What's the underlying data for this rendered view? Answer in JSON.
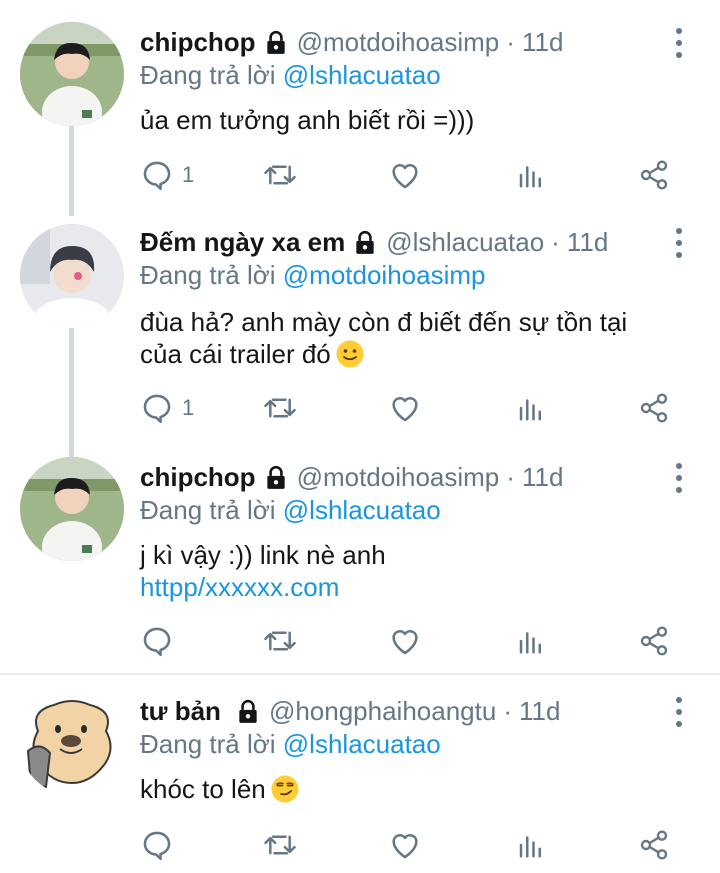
{
  "tweets": [
    {
      "name": "chipchop",
      "handle": "@motdoihoasimp",
      "dot": "·",
      "time": "11d",
      "reply_prefix": "Đang trả lời ",
      "reply_to": "@lshlacuatao",
      "text_lines": [
        "ủa em tưởng anh biết rồi =)))"
      ],
      "reply_count": "1",
      "avatar": "boy-photo-avatar"
    },
    {
      "name": "Đếm ngày xa em",
      "handle": "@lshlacuatao",
      "dot": "·",
      "time": "11d",
      "reply_prefix": "Đang trả lời ",
      "reply_to": "@motdoihoasimp",
      "text_lines": [
        "đùa hả? anh mày còn đ biết đến sự tồn tại",
        "của cái trailer đó"
      ],
      "emoji": "slightly-smiling-face",
      "reply_count": "1",
      "avatar": "selfie-photo-avatar"
    },
    {
      "name": "chipchop",
      "handle": "@motdoihoasimp",
      "dot": "·",
      "time": "11d",
      "reply_prefix": "Đang trả lời ",
      "reply_to": "@lshlacuatao",
      "text_lines": [
        "j kì vậy :)) link nè anh"
      ],
      "link": "httpp/xxxxxx.com",
      "reply_count": "",
      "avatar": "boy-photo-avatar"
    },
    {
      "name": "tư bản",
      "handle": "@hongphaihoangtu",
      "dot": "·",
      "time": "11d",
      "reply_prefix": "Đang trả lời ",
      "reply_to": "@lshlacuatao",
      "text_lines": [
        "khóc to lên"
      ],
      "emoji": "smirking-face",
      "reply_count": "",
      "avatar": "cartoon-dog-avatar"
    }
  ],
  "colors": {
    "text": "#14171a",
    "muted": "#657786",
    "link": "#1b95e0",
    "thread_line": "#cfd9de",
    "divider": "#e6ecf0"
  },
  "icons": [
    "lock-icon",
    "more-icon",
    "reply-icon",
    "retweet-icon",
    "like-icon",
    "stats-icon",
    "share-icon"
  ]
}
